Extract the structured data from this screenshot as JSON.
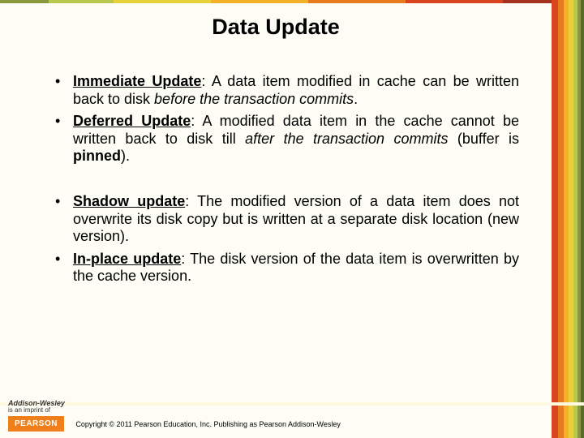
{
  "title": "Data Update",
  "bullets": {
    "b1": {
      "label": "Immediate Update",
      "sep": ":",
      "spacer": "  ",
      "t1": "A data item modified in cache can be written back to disk ",
      "em": "before the transaction commits",
      "t2": "."
    },
    "b2": {
      "label": "Deferred Update",
      "sep": ":",
      "spacer": "  ",
      "t1": "A modified data item in the cache cannot be written back to disk till ",
      "em": "after the transaction commits",
      "t2": " (buffer is ",
      "strong2": "pinned",
      "t3": ")."
    },
    "b3": {
      "label": "Shadow update",
      "sep": ":",
      "spacer": "   ",
      "t1": "The modified version of a data item does not overwrite its disk copy but is written at a separate disk location (new version)."
    },
    "b4": {
      "label": "In-place update",
      "sep": ":",
      "spacer": " ",
      "t1": "The disk version of the data item is overwritten by the cache version."
    }
  },
  "footer": {
    "brand": "Addison-Wesley",
    "imprint_line": "is an imprint of",
    "logo": "PEARSON",
    "copyright": "Copyright © 2011 Pearson Education, Inc. Publishing as Pearson Addison-Wesley"
  },
  "stripe_colors": {
    "top": [
      "#8a9a3a",
      "#b8c94f",
      "#e7d13a",
      "#f3b12a",
      "#e77c1f",
      "#d9431e",
      "#a6331d"
    ],
    "right": [
      "#d9431e",
      "#e77c1f",
      "#f3b12a",
      "#e7d13a",
      "#b8c94f",
      "#8a9a3a",
      "#5a6a2a"
    ]
  }
}
